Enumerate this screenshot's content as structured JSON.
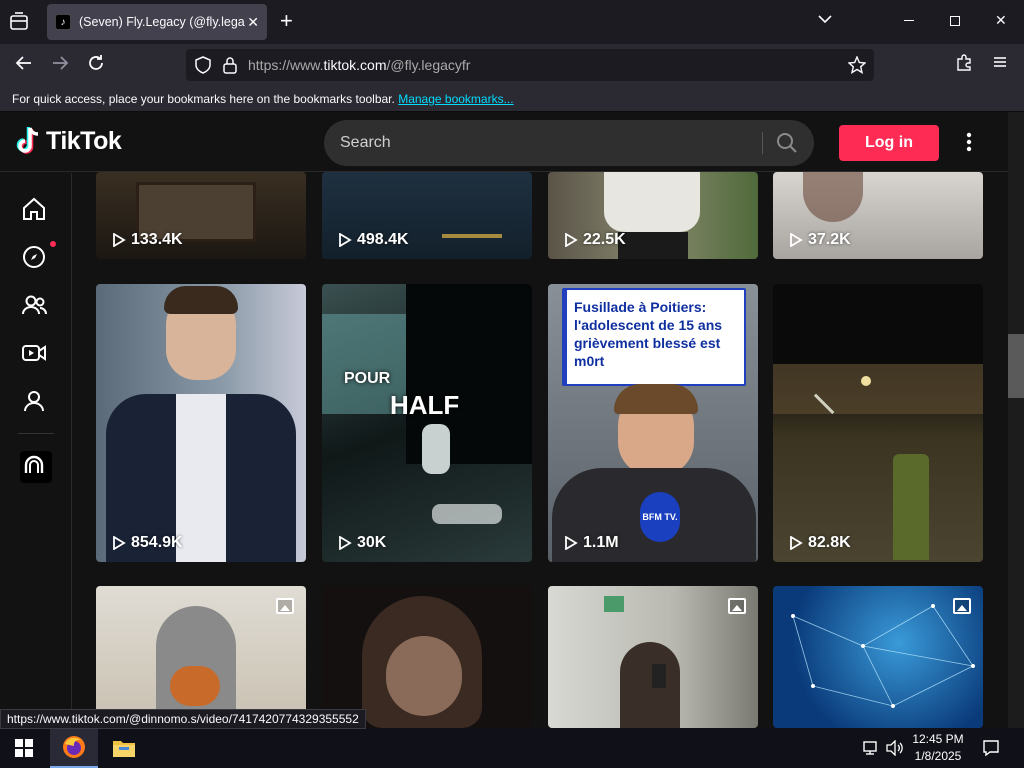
{
  "browser": {
    "tab_title": "(Seven) Fly.Legacy (@fly.legacyfr",
    "url_prefix": "https://www.",
    "url_domain": "tiktok.com",
    "url_path": "/@fly.legacyfr",
    "bookmark_hint": "For quick access, place your bookmarks here on the bookmarks toolbar.",
    "bookmark_link": "Manage bookmarks...",
    "status_url": "https://www.tiktok.com/@dinnomo.s/video/7417420774329355552"
  },
  "tiktok": {
    "logo_text": "TikTok",
    "search_placeholder": "Search",
    "login_label": "Log in"
  },
  "sidebar": {
    "items": [
      "home-icon",
      "explore-icon",
      "following-icon",
      "live-icon",
      "profile-icon",
      "creator-icon"
    ]
  },
  "grid": {
    "row1": [
      "133.4K",
      "498.4K",
      "22.5K",
      "37.2K"
    ],
    "row2": [
      "854.9K",
      "30K",
      "1.1M",
      "82.8K"
    ],
    "overlays": {
      "half_word1": "POUR",
      "half_word2": "HALF",
      "news_headline": "Fusillade à Poitiers: l'adolescent de 15 ans grièvement blessé est m0rt",
      "news_logo": "BFM TV."
    }
  },
  "taskbar": {
    "time": "12:45 PM",
    "date": "1/8/2025"
  },
  "colors": {
    "accent": "#fe2c55",
    "link": "#00ddff"
  }
}
